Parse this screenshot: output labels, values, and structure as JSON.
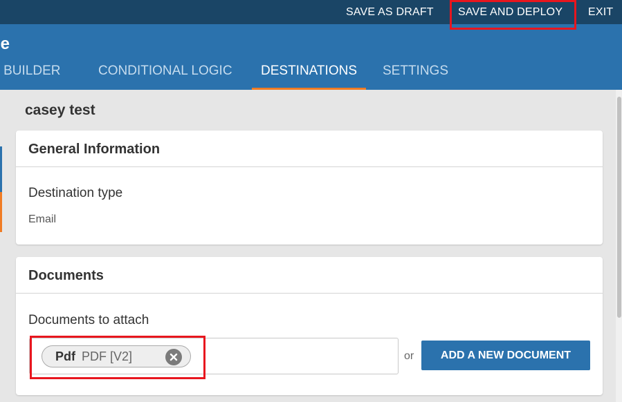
{
  "toolbar": {
    "save_draft": "SAVE AS DRAFT",
    "save_deploy": "SAVE AND DEPLOY",
    "exit": "EXIT"
  },
  "header": {
    "form_name": "ge",
    "tabs": [
      {
        "label": "M BUILDER",
        "active": false
      },
      {
        "label": "CONDITIONAL LOGIC",
        "active": false
      },
      {
        "label": "DESTINATIONS",
        "active": true
      },
      {
        "label": "SETTINGS",
        "active": false
      }
    ]
  },
  "destination": {
    "title": "casey test",
    "general": {
      "heading": "General Information",
      "type_label": "Destination type",
      "type_value": "Email"
    },
    "documents": {
      "heading": "Documents",
      "attach_label": "Documents to attach",
      "chip_name": "Pdf",
      "chip_detail": "PDF [V2]",
      "or_text": "or",
      "add_button": "ADD A NEW DOCUMENT"
    }
  },
  "colors": {
    "topbar": "#1a4566",
    "header": "#2b72ad",
    "active_tab_underline": "#f07c24",
    "highlight": "#e8161e",
    "primary_button": "#2b72ad"
  },
  "icons": {
    "chip_remove": "close-circle-icon"
  }
}
